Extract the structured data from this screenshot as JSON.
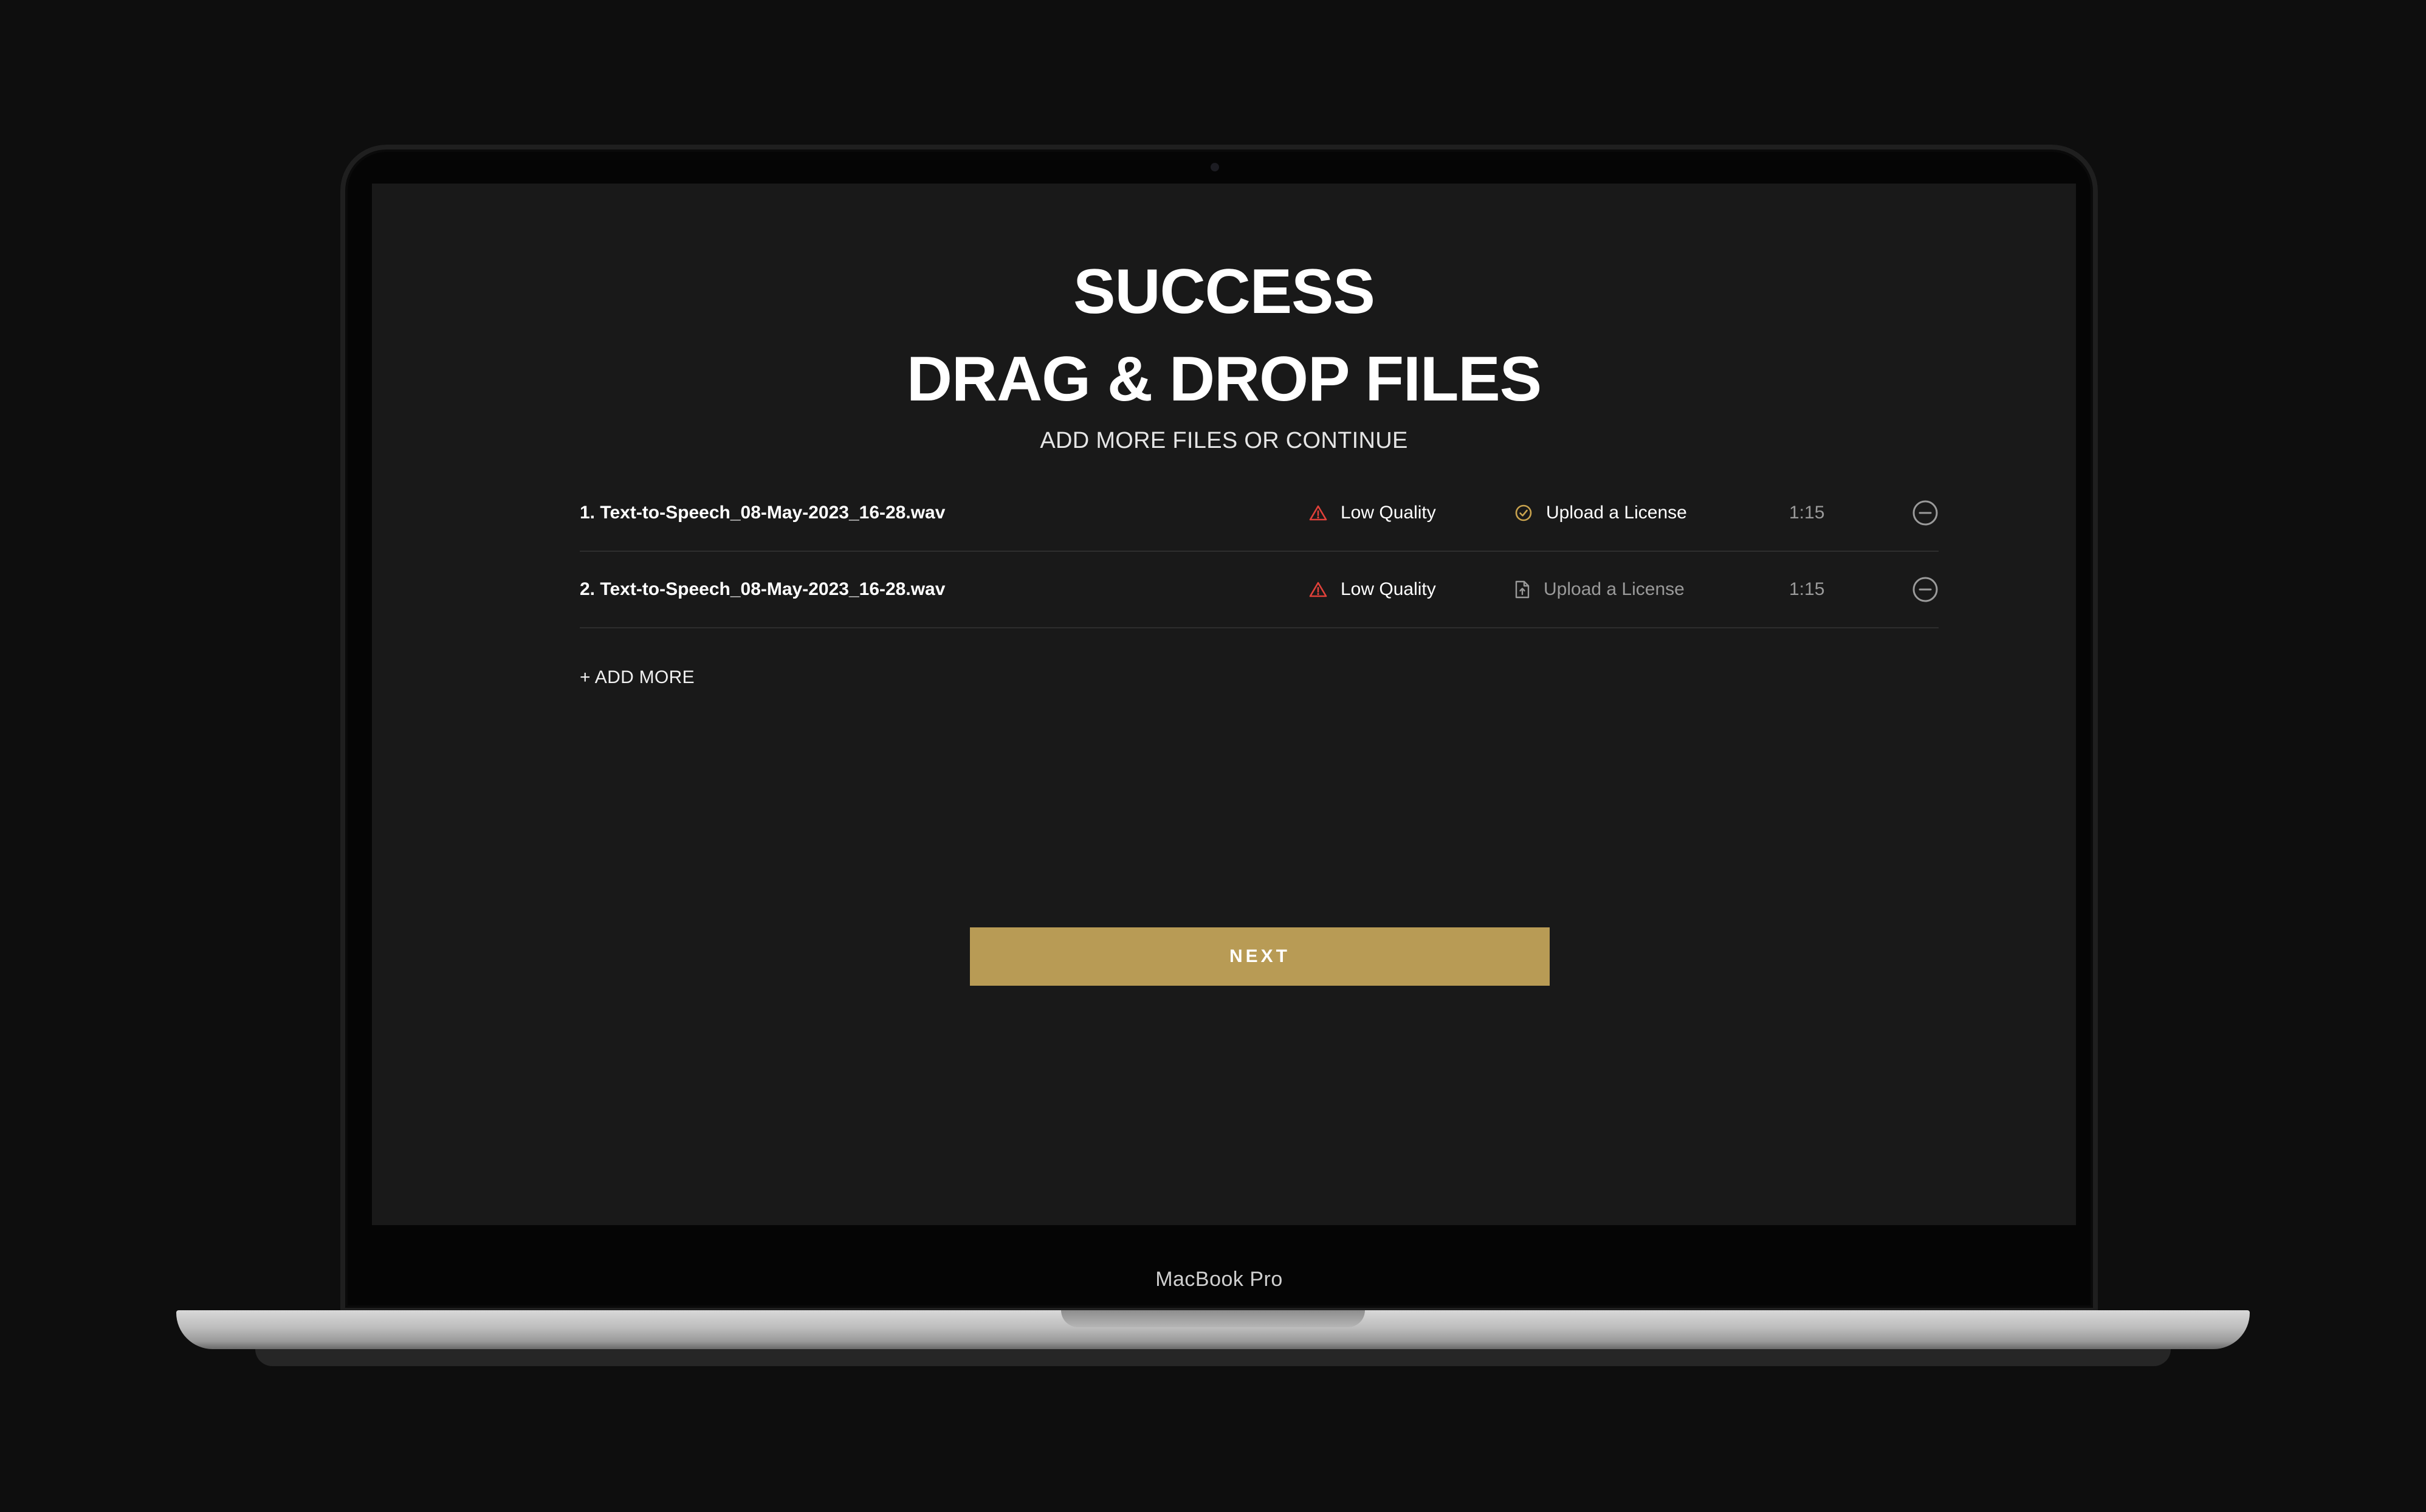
{
  "device": {
    "label": "MacBook Pro"
  },
  "page": {
    "title_line1": "SUCCESS",
    "title_line2": "DRAG & DROP FILES",
    "subtitle": "ADD MORE FILES OR CONTINUE"
  },
  "files": [
    {
      "name": "1. Text-to-Speech_08-May-2023_16-28.wav",
      "quality": "Low Quality",
      "license": "Upload a License",
      "license_state": "done",
      "duration": "1:15"
    },
    {
      "name": "2. Text-to-Speech_08-May-2023_16-28.wav",
      "quality": "Low Quality",
      "license": "Upload a License",
      "license_state": "pending",
      "duration": "1:15"
    }
  ],
  "actions": {
    "add_more": "+ ADD MORE",
    "next": "NEXT"
  },
  "colors": {
    "accent": "#b89b55",
    "warning": "#e0413a",
    "screen_bg": "#191919",
    "check": "#c9a34e"
  }
}
